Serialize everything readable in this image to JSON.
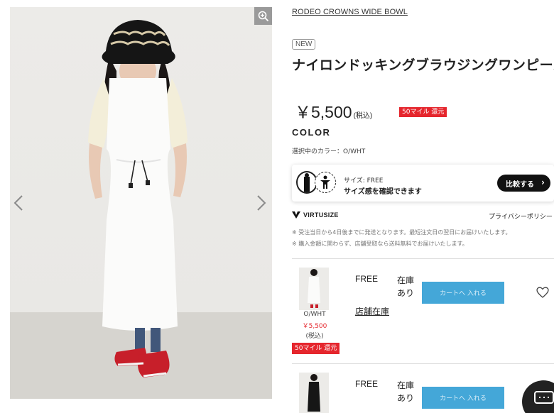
{
  "product": {
    "brand": "RODEO CROWNS WIDE BOWL",
    "new_badge": "NEW",
    "title": "ナイロンドッキングブラウジングワンピース",
    "price": "￥5,500",
    "tax_label": "(税込)",
    "mile_badge": "50マイル 還元",
    "color_heading": "COLOR",
    "selected_color": "選択中のカラー：O/WHT"
  },
  "virtusize": {
    "size_line": "サイズ: FREE",
    "size_prompt": "サイズ感を確認できます",
    "compare_label": "比較する",
    "logo_text": "VIRTUSIZE",
    "privacy_label": "プライバシーポリシー"
  },
  "notes": [
    "※ 受注当日から4日後までに発送となります。最短注文日の翌日にお届けいたします。",
    "※ 購入金額に関わらず、店舗受取なら送料無料でお届けいたします。"
  ],
  "variants": [
    {
      "color": "O/WHT",
      "price": "￥5,500",
      "tax": "(税込)",
      "mile": "50マイル 還元",
      "size": "FREE",
      "stock": "在庫あり",
      "cart_label": "カートへ 入れる",
      "store_stock_label": "店舗在庫"
    },
    {
      "color": "",
      "price": "",
      "tax": "",
      "mile": "",
      "size": "FREE",
      "stock": "在庫あり",
      "cart_label": "カートへ 入れる",
      "store_stock_label": ""
    }
  ],
  "colors": {
    "accent_red": "#e5262d",
    "cart_blue": "#44a7d8",
    "compare_black": "#111111"
  },
  "icons": [
    "zoom-icon",
    "chevron-left-icon",
    "chevron-right-icon",
    "person-icon",
    "virtusize-logo-icon",
    "heart-icon",
    "chat-icon"
  ]
}
